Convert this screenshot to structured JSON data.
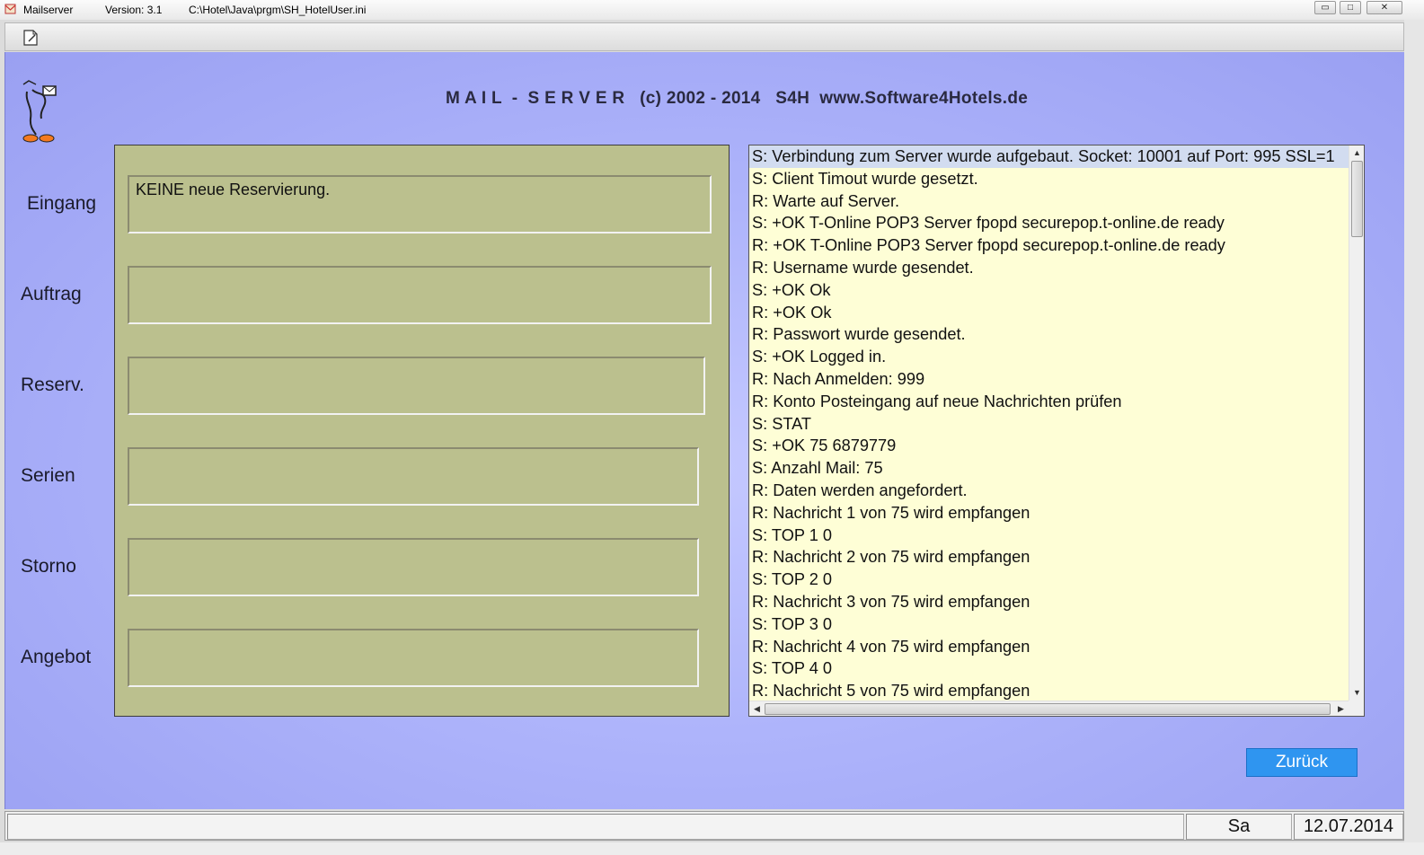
{
  "window": {
    "app_name": "Mailserver",
    "version": "Version: 3.1",
    "path": "C:\\Hotel\\Java\\prgm\\SH_HotelUser.ini",
    "min_symbol": "▭",
    "max_symbol": "□",
    "close_symbol": "✕"
  },
  "header": {
    "title": "M A I L  -  S E R V E R   (c) 2002 - 2014   S4H  www.Software4Hotels.de"
  },
  "side_labels": {
    "eingang": "Eingang",
    "auftrag": "Auftrag",
    "reserv": "Reserv.",
    "serien": "Serien",
    "storno": "Storno",
    "angebot": "Angebot"
  },
  "fields": {
    "eingang": "KEINE neue Reservierung.",
    "auftrag": "",
    "reserv": "",
    "serien": "",
    "storno": "",
    "angebot": ""
  },
  "log": {
    "lines": [
      "S: Verbindung zum Server wurde aufgebaut. Socket: 10001 auf Port: 995 SSL=1",
      "S: Client Timout wurde gesetzt.",
      "R: Warte auf Server.",
      "S: +OK T-Online POP3 Server fpopd securepop.t-online.de ready",
      "R: +OK T-Online POP3 Server fpopd securepop.t-online.de ready",
      "R: Username wurde gesendet.",
      "S: +OK Ok",
      "R: +OK Ok",
      "R: Passwort wurde gesendet.",
      "S: +OK Logged in.",
      "R: Nach Anmelden:  999",
      "R: Konto Posteingang auf neue Nachrichten prüfen",
      "S: STAT",
      "S: +OK 75 6879779",
      "S: Anzahl Mail: 75",
      "R: Daten werden angefordert.",
      "R: Nachricht 1 von 75 wird empfangen",
      "S: TOP 1 0",
      "R: Nachricht 2 von 75 wird empfangen",
      "S: TOP 2 0",
      "R: Nachricht 3 von 75 wird empfangen",
      "S: TOP 3 0",
      "R: Nachricht 4 von 75 wird empfangen",
      "S: TOP 4 0",
      "R: Nachricht 5 von 75 wird empfangen"
    ],
    "up_arrow": "▲",
    "down_arrow": "▼",
    "left_arrow": "◀",
    "right_arrow": "▶"
  },
  "buttons": {
    "back": "Zurück"
  },
  "status": {
    "day": "Sa",
    "date": "12.07.2014"
  },
  "colors": {
    "panel_bg": "#aeb4fb",
    "olive": "#bbc08e",
    "log_bg": "#fefed6",
    "button": "#2f95f0"
  }
}
